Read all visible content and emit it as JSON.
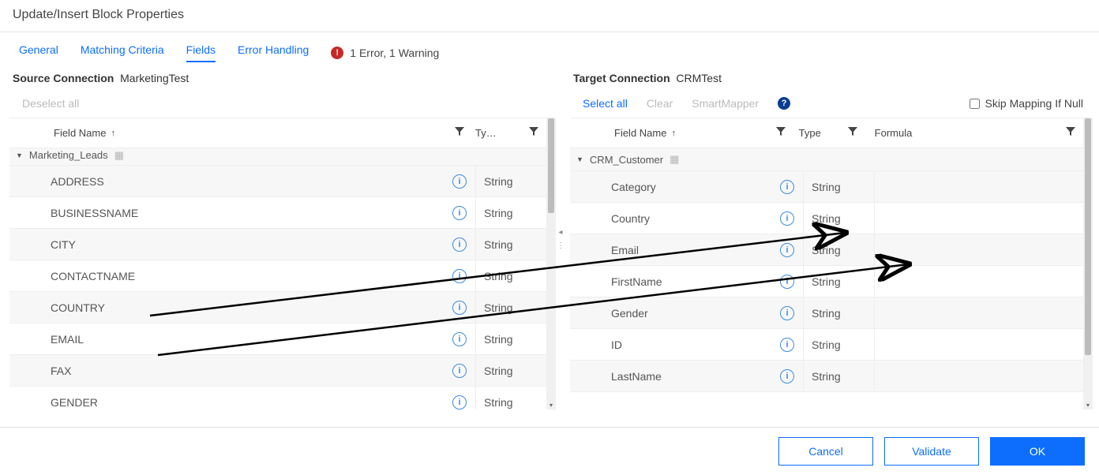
{
  "header": {
    "title": "Update/Insert Block Properties"
  },
  "tabs": {
    "general": "General",
    "matching": "Matching Criteria",
    "fields": "Fields",
    "error": "Error Handling",
    "alert_text": "1 Error, 1 Warning"
  },
  "source": {
    "label": "Source Connection",
    "name": "MarketingTest",
    "deselect": "Deselect all",
    "cols": {
      "name": "Field Name",
      "type": "Ty…"
    },
    "group": "Marketing_Leads",
    "type_value": "String",
    "fields": [
      "ADDRESS",
      "BUSINESSNAME",
      "CITY",
      "CONTACTNAME",
      "COUNTRY",
      "EMAIL",
      "FAX",
      "GENDER"
    ]
  },
  "target": {
    "label": "Target Connection",
    "name": "CRMTest",
    "selectall": "Select all",
    "clear": "Clear",
    "smartmapper": "SmartMapper",
    "skip": "Skip Mapping If Null",
    "cols": {
      "name": "Field Name",
      "type": "Type",
      "formula": "Formula"
    },
    "group": "CRM_Customer",
    "type_value": "String",
    "fields": [
      "Category",
      "Country",
      "Email",
      "FirstName",
      "Gender",
      "ID",
      "LastName"
    ]
  },
  "footer": {
    "cancel": "Cancel",
    "validate": "Validate",
    "ok": "OK"
  }
}
